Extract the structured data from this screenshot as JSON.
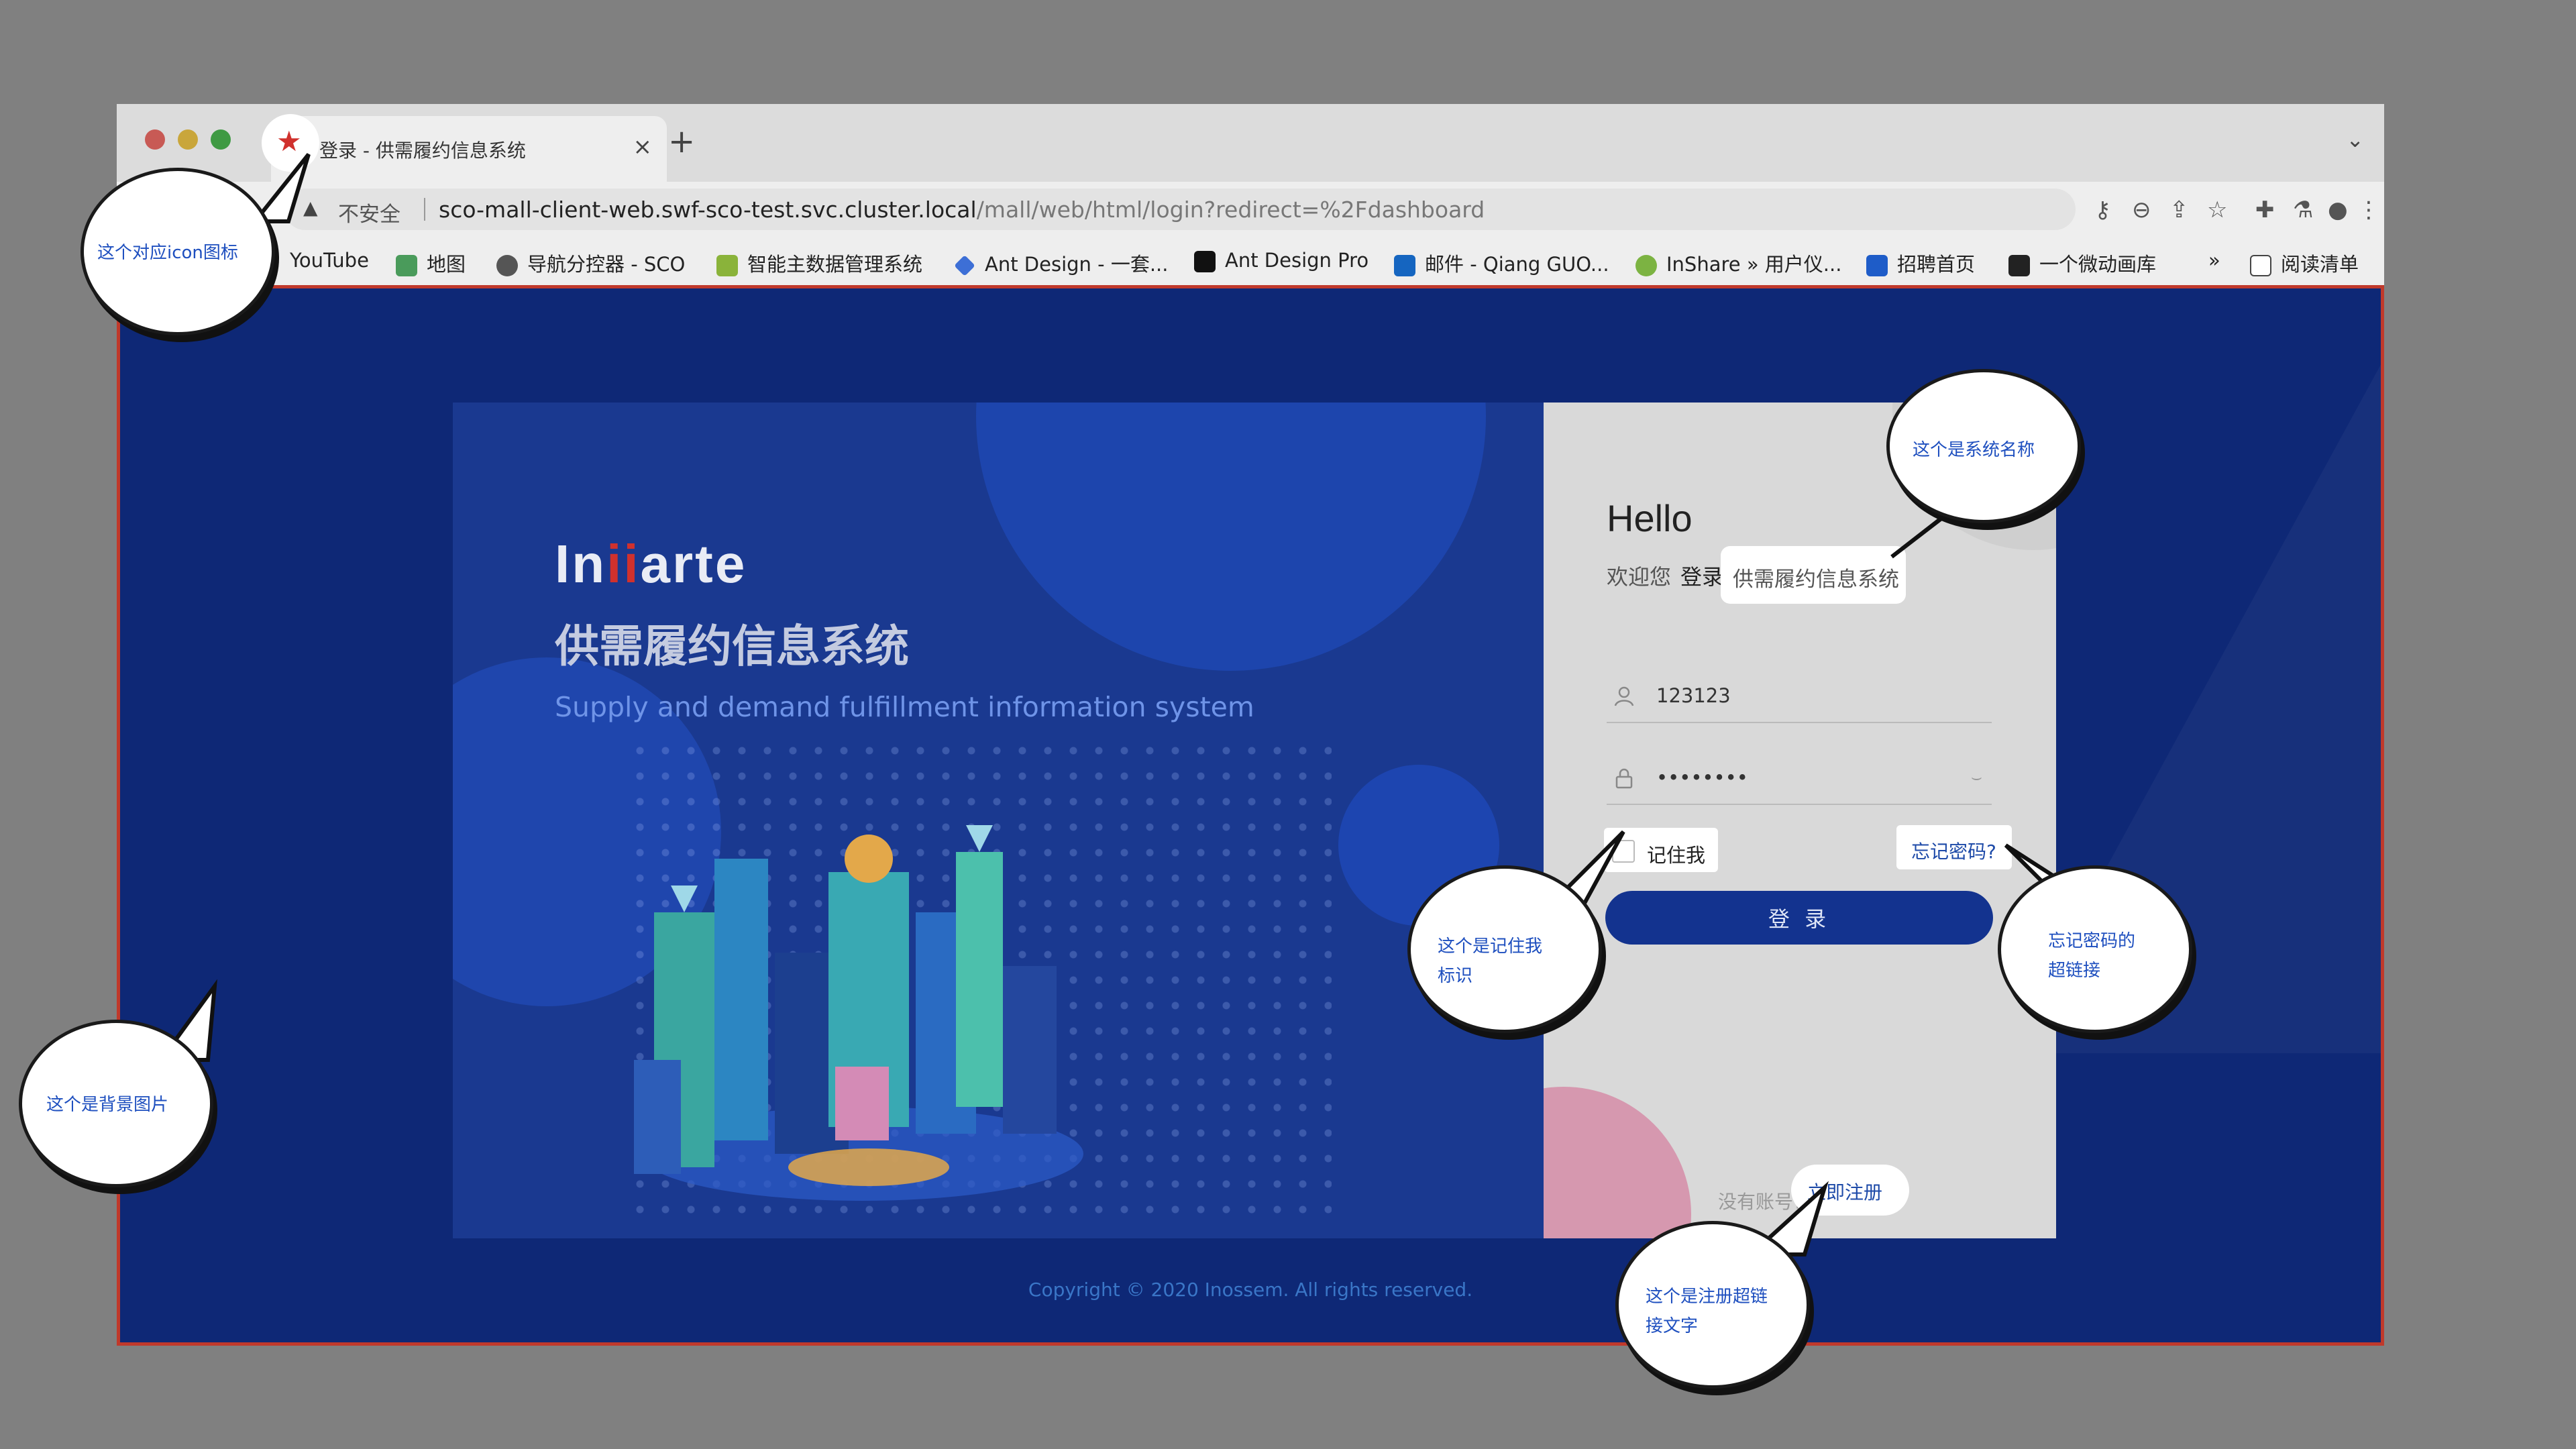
{
  "browser": {
    "tab_title": "登录 - 供需履约信息系统",
    "tab_close": "×",
    "new_tab": "+",
    "tab_menu": "⌄",
    "security_label": "不安全",
    "url_host": "sco-mall-client-web.swf-sco-test.svc.cluster.local",
    "url_path": "/mall/web/html/login?redirect=%2Fdashboard",
    "bookmarks": [
      {
        "label": "YouTube"
      },
      {
        "label": "地图"
      },
      {
        "label": "导航分控器 - SCO"
      },
      {
        "label": "智能主数据管理系统"
      },
      {
        "label": "Ant Design - 一套..."
      },
      {
        "label": "Ant Design Pro"
      },
      {
        "label": "邮件 - Qiang GUO..."
      },
      {
        "label": "InShare » 用户仪..."
      },
      {
        "label": "招聘首页"
      },
      {
        "label": "一个微动画库"
      },
      {
        "label": "»"
      },
      {
        "label": "阅读清单"
      }
    ]
  },
  "login": {
    "logo_prefix": "In",
    "logo_mark": "ii",
    "logo_mid": "arte",
    "system_title": "供需履约信息系统",
    "system_subtitle": "Supply and demand fulfillment information system",
    "hello": "Hello",
    "welcome": "欢迎您",
    "login_word": "登录",
    "system_name": "供需履约信息系统",
    "username_value": "123123",
    "password_value": "••••••••",
    "remember_label": "记住我",
    "forgot_label": "忘记密码?",
    "submit_label": "登 录",
    "no_account": "没有账号?",
    "register_label": "立即注册",
    "copyright": "Copyright © 2020 Inossem. All rights reserved."
  },
  "annotations": {
    "favicon_note": "这个对应icon图标",
    "system_name_note": "这个是系统名称",
    "remember_note_1": "这个是记住我",
    "remember_note_2": "标识",
    "forgot_note_1": "忘记密码的",
    "forgot_note_2": "超链接",
    "background_note": "这个是背景图片",
    "register_note_1": "这个是注册超链",
    "register_note_2": "接文字"
  },
  "colors": {
    "page_bg": "#0e2876",
    "left_panel": "#1a3990",
    "accent": "#13338f",
    "link": "#1d4aa8"
  }
}
